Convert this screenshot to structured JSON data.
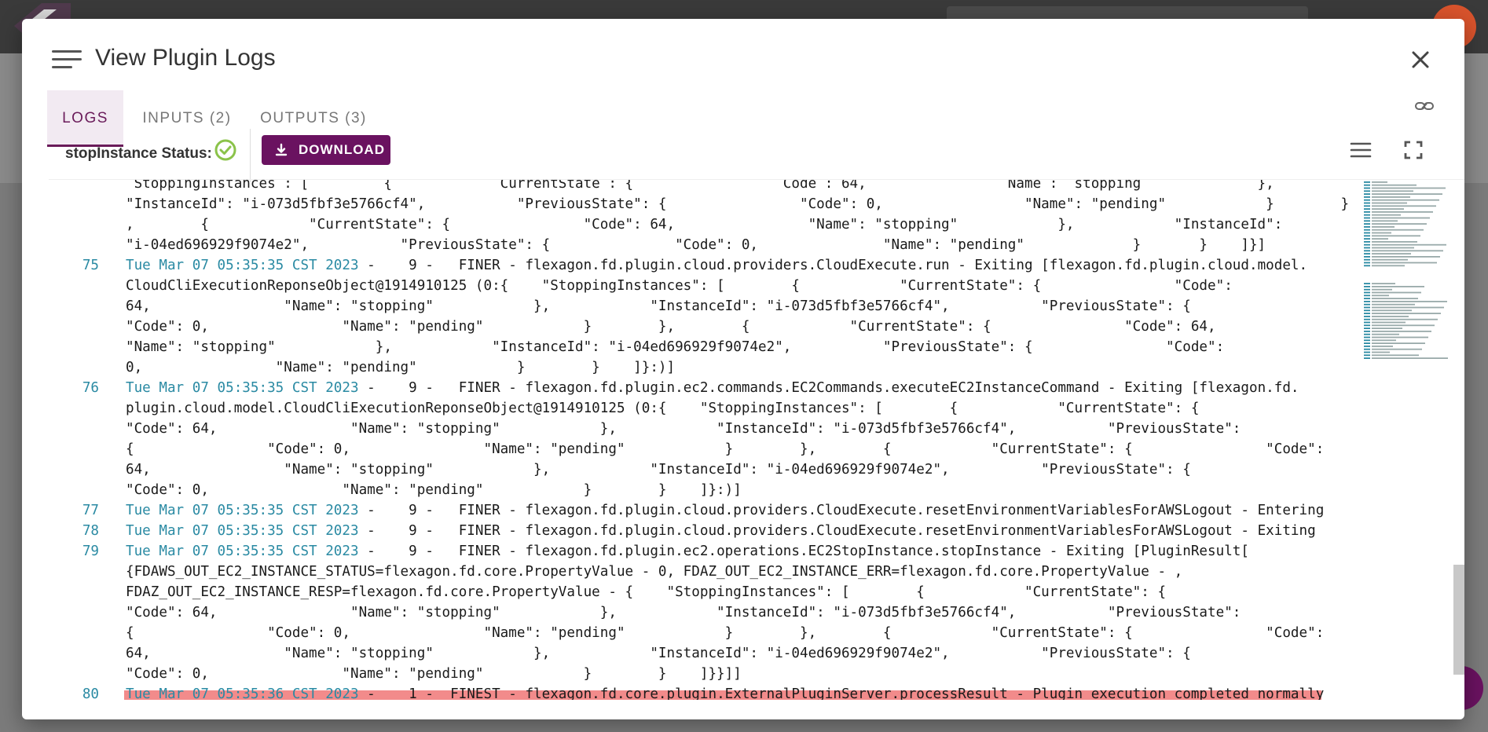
{
  "dialog": {
    "title": "View Plugin Logs",
    "tabs": [
      {
        "label": "LOGS",
        "active": true
      },
      {
        "label": "INPUTS (2)",
        "active": false
      },
      {
        "label": "OUTPUTS (3)",
        "active": false
      }
    ],
    "status_label": "stopInstance Status:",
    "status": "success",
    "download_label": "DOWNLOAD",
    "icons": [
      "menu-icon",
      "close-icon",
      "link-icon",
      "check-circle-icon",
      "download-icon",
      "list-icon",
      "fullscreen-icon"
    ]
  },
  "log": {
    "lines": [
      {
        "n": "",
        "ts": "",
        "text": " StoppingInstances : [         {             CurrentState : {                  Code : 64,                 Name :  stopping              },"
      },
      {
        "n": "",
        "ts": "",
        "text": "\"InstanceId\": \"i-073d5fbf3e5766cf4\",           \"PreviousState\": {                \"Code\": 0,                 \"Name\": \"pending\"            }        }"
      },
      {
        "n": "",
        "ts": "",
        "text": ",        {            \"CurrentState\": {                \"Code\": 64,                \"Name\": \"stopping\"            },            \"InstanceId\":"
      },
      {
        "n": "",
        "ts": "",
        "text": "\"i-04ed696929f9074e2\",           \"PreviousState\": {               \"Code\": 0,               \"Name\": \"pending\"             }       }    ]}]"
      },
      {
        "n": "75",
        "ts": "Tue Mar 07 05:35:35 CST 2023",
        "text": " -    9 -   FINER - flexagon.fd.plugin.cloud.providers.CloudExecute.run - Exiting [flexagon.fd.plugin.cloud.model."
      },
      {
        "n": "",
        "ts": "",
        "text": "CloudCliExecutionReponseObject@1914910125 (0:{    \"StoppingInstances\": [        {            \"CurrentState\": {                \"Code\":"
      },
      {
        "n": "",
        "ts": "",
        "text": "64,                \"Name\": \"stopping\"            },            \"InstanceId\": \"i-073d5fbf3e5766cf4\",           \"PreviousState\": {"
      },
      {
        "n": "",
        "ts": "",
        "text": "\"Code\": 0,                \"Name\": \"pending\"            }        },        {            \"CurrentState\": {                \"Code\": 64,"
      },
      {
        "n": "",
        "ts": "",
        "text": "\"Name\": \"stopping\"            },            \"InstanceId\": \"i-04ed696929f9074e2\",           \"PreviousState\": {                \"Code\":"
      },
      {
        "n": "",
        "ts": "",
        "text": "0,                \"Name\": \"pending\"            }        }    ]}:)]"
      },
      {
        "n": "76",
        "ts": "Tue Mar 07 05:35:35 CST 2023",
        "text": " -    9 -   FINER - flexagon.fd.plugin.ec2.commands.EC2Commands.executeEC2InstanceCommand - Exiting [flexagon.fd."
      },
      {
        "n": "",
        "ts": "",
        "text": "plugin.cloud.model.CloudCliExecutionReponseObject@1914910125 (0:{    \"StoppingInstances\": [        {            \"CurrentState\": {"
      },
      {
        "n": "",
        "ts": "",
        "text": "\"Code\": 64,                \"Name\": \"stopping\"            },            \"InstanceId\": \"i-073d5fbf3e5766cf4\",           \"PreviousState\":"
      },
      {
        "n": "",
        "ts": "",
        "text": "{                \"Code\": 0,                \"Name\": \"pending\"            }        },        {            \"CurrentState\": {                \"Code\":"
      },
      {
        "n": "",
        "ts": "",
        "text": "64,                \"Name\": \"stopping\"            },            \"InstanceId\": \"i-04ed696929f9074e2\",           \"PreviousState\": {"
      },
      {
        "n": "",
        "ts": "",
        "text": "\"Code\": 0,                \"Name\": \"pending\"            }        }    ]}:)]"
      },
      {
        "n": "77",
        "ts": "Tue Mar 07 05:35:35 CST 2023",
        "text": " -    9 -   FINER - flexagon.fd.plugin.cloud.providers.CloudExecute.resetEnvironmentVariablesForAWSLogout - Entering"
      },
      {
        "n": "78",
        "ts": "Tue Mar 07 05:35:35 CST 2023",
        "text": " -    9 -   FINER - flexagon.fd.plugin.cloud.providers.CloudExecute.resetEnvironmentVariablesForAWSLogout - Exiting"
      },
      {
        "n": "79",
        "ts": "Tue Mar 07 05:35:35 CST 2023",
        "text": " -    9 -   FINER - flexagon.fd.plugin.ec2.operations.EC2StopInstance.stopInstance - Exiting [PluginResult["
      },
      {
        "n": "",
        "ts": "",
        "text": "{FDAWS_OUT_EC2_INSTANCE_STATUS=flexagon.fd.core.PropertyValue - 0, FDAZ_OUT_EC2_INSTANCE_ERR=flexagon.fd.core.PropertyValue - ,"
      },
      {
        "n": "",
        "ts": "",
        "text": "FDAZ_OUT_EC2_INSTANCE_RESP=flexagon.fd.core.PropertyValue - {    \"StoppingInstances\": [        {            \"CurrentState\": {"
      },
      {
        "n": "",
        "ts": "",
        "text": "\"Code\": 64,                \"Name\": \"stopping\"            },            \"InstanceId\": \"i-073d5fbf3e5766cf4\",           \"PreviousState\":"
      },
      {
        "n": "",
        "ts": "",
        "text": "{                \"Code\": 0,                \"Name\": \"pending\"            }        },        {            \"CurrentState\": {                \"Code\":"
      },
      {
        "n": "",
        "ts": "",
        "text": "64,                \"Name\": \"stopping\"            },            \"InstanceId\": \"i-04ed696929f9074e2\",           \"PreviousState\": {"
      },
      {
        "n": "",
        "ts": "",
        "text": "\"Code\": 0,                \"Name\": \"pending\"            }        }    ]}}]]"
      },
      {
        "n": "80",
        "ts": "Tue Mar 07 05:35:36 CST 2023",
        "text": " -    1 -  FINEST - flexagon.fd.core.plugin.ExternalPluginServer.processResult - Plugin execution completed normally",
        "highlight": true
      }
    ]
  },
  "colors": {
    "accent": "#6a1260",
    "success": "#8bc34a",
    "timestamp": "#2a8aa3",
    "highlight": "#f28b8b"
  }
}
